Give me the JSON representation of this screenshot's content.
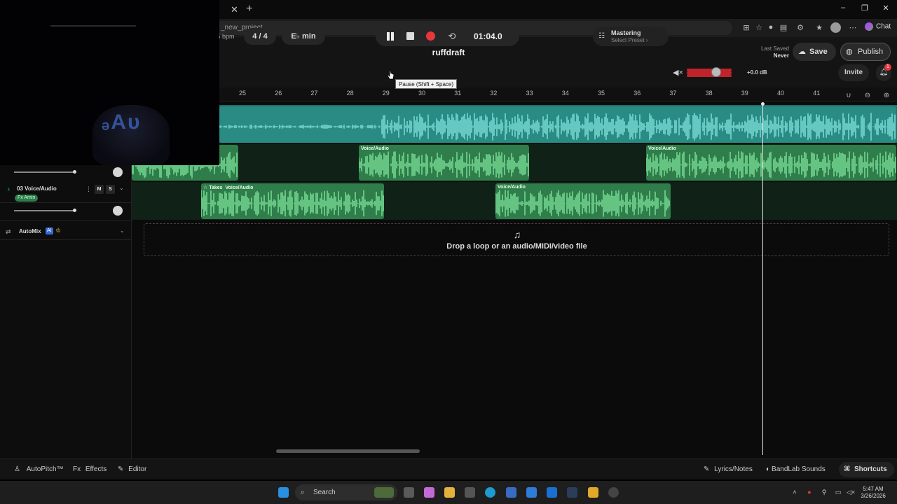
{
  "browser": {
    "url": "_new_project",
    "chat_label": "Chat",
    "win_min": "–",
    "win_max": "❐",
    "win_close": "✕"
  },
  "header": {
    "title": "ruffdraft",
    "bpm_label": "5 bpm",
    "time_signature": "4 / 4",
    "key": "E♭ min",
    "time": "01:04.0",
    "tooltip": "Pause (Shift + Space)",
    "mastering_title": "Mastering",
    "mastering_preset": "Select Preset ›",
    "volume_db": "+0.0 dB",
    "volume_level": 0.66,
    "last_saved_label": "Last Saved",
    "last_saved_value": "Never",
    "save_label": "Save",
    "publish_label": "Publish",
    "invite_label": "Invite",
    "notifications_count": "1"
  },
  "ruler": {
    "bars": [
      "25",
      "26",
      "27",
      "28",
      "29",
      "30",
      "31",
      "32",
      "33",
      "34",
      "35",
      "36",
      "37",
      "38",
      "39",
      "40",
      "41"
    ]
  },
  "tracks": {
    "track3": {
      "number_name": "03 Voice/Audio",
      "mute": "M",
      "solo": "S",
      "fx": "Fx Amin"
    },
    "automix": {
      "label": "AutoMix",
      "badge": "AI"
    }
  },
  "regions": {
    "voice_label": "Voice/Audio",
    "takes_label": "Takes"
  },
  "drop_zone": {
    "text": "Drop a loop or an audio/MIDI/video file"
  },
  "bottom_bar": {
    "autopitch": "AutoPitch™",
    "effects": "Effects",
    "editor": "Editor",
    "lyrics": "Lyrics/Notes",
    "sounds": "BandLab Sounds",
    "shortcuts": "Shortcuts"
  },
  "taskbar": {
    "search": "Search",
    "time": "5:47 AM",
    "date": "3/26/2026"
  },
  "colors": {
    "track1": "#2a8a84",
    "track_green": "#2e7d4a",
    "record": "#e5383b"
  }
}
